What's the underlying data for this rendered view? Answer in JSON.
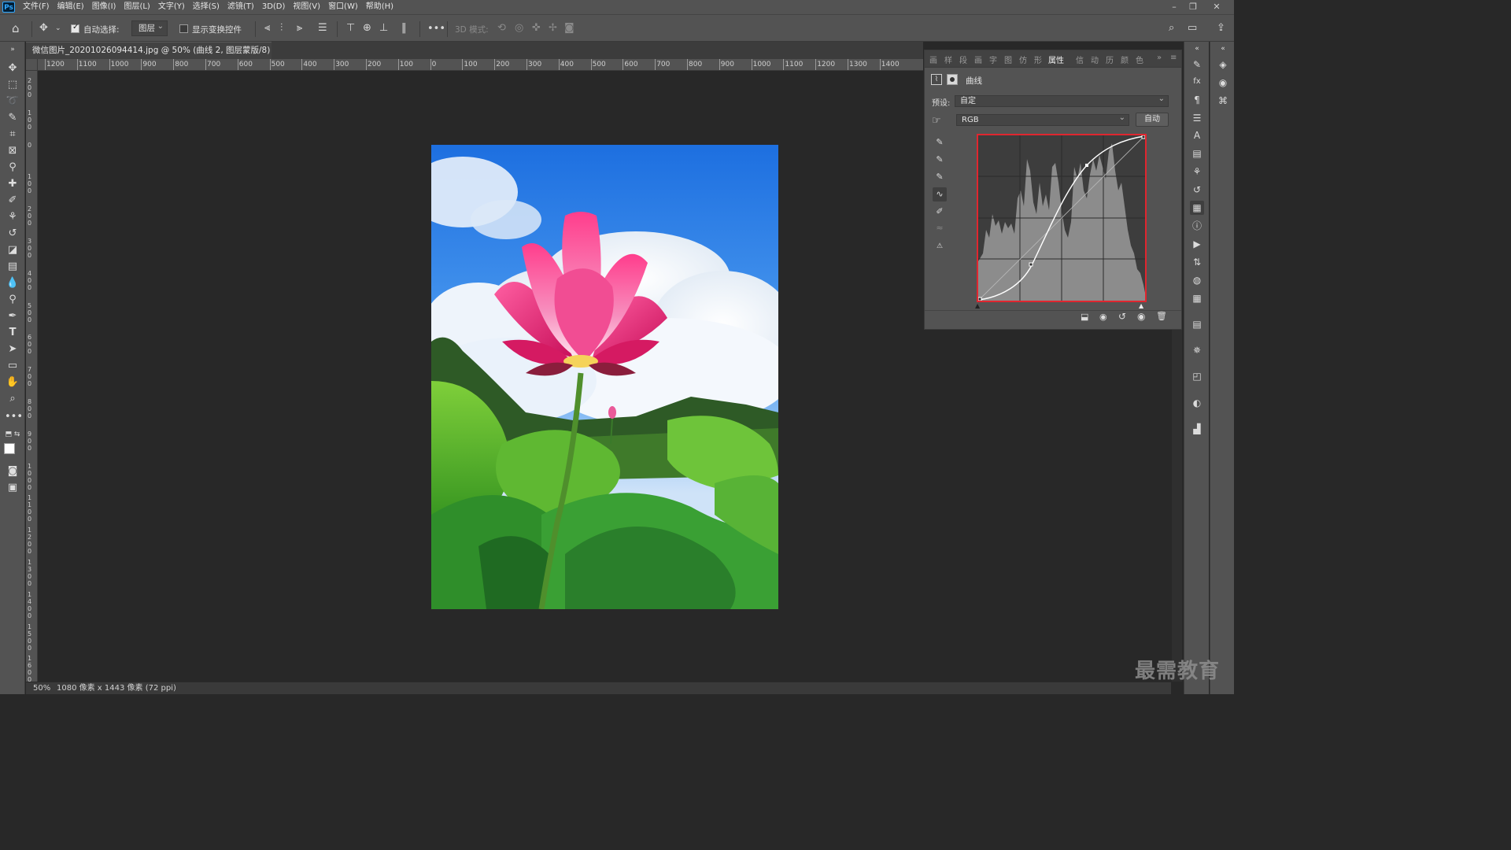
{
  "app": {
    "logo": "Ps"
  },
  "menu": [
    "文件(F)",
    "编辑(E)",
    "图像(I)",
    "图层(L)",
    "文字(Y)",
    "选择(S)",
    "滤镜(T)",
    "3D(D)",
    "视图(V)",
    "窗口(W)",
    "帮助(H)"
  ],
  "window_controls": {
    "minimize": "–",
    "restore": "❐",
    "close": "✕"
  },
  "options": {
    "auto_select_label": "自动选择:",
    "auto_select_checked": true,
    "auto_select_target": "图层",
    "show_transform_label": "显示变换控件",
    "show_transform_checked": false,
    "more": "•••",
    "mode3d_label": "3D 模式:"
  },
  "document": {
    "tab_title": "微信图片_20201026094414.jpg @ 50% (曲线 2, 图层蒙版/8) *",
    "tab_close": "×"
  },
  "ruler": {
    "h_labels": [
      "1200",
      "1100",
      "1000",
      "900",
      "800",
      "700",
      "600",
      "500",
      "400",
      "300",
      "200",
      "100",
      "0",
      "100",
      "200",
      "300",
      "400",
      "500",
      "600",
      "700",
      "800",
      "900",
      "1000",
      "1100",
      "1200",
      "1300",
      "1400"
    ],
    "v_labels": [
      "200",
      "100",
      "0",
      "100",
      "200",
      "300",
      "400",
      "500",
      "600",
      "700",
      "800",
      "900",
      "1000",
      "1100",
      "1200",
      "1300",
      "1400",
      "1500",
      "1600"
    ]
  },
  "status": {
    "zoom": "50%",
    "info": "1080 像素 x 1443 像素 (72 ppi)",
    "arrow": "›"
  },
  "properties_panel": {
    "tabs": [
      "画",
      "样",
      "段",
      "画",
      "字",
      "图",
      "仿",
      "形",
      "属性",
      "信",
      "动",
      "历",
      "颜",
      "色"
    ],
    "active_tab": "属性",
    "expand": "»",
    "menu": "≡",
    "adjustment_title": "曲线",
    "preset_label": "预设:",
    "preset_value": "自定",
    "channel_value": "RGB",
    "auto_button": "自动"
  },
  "watermark": "最需教育"
}
